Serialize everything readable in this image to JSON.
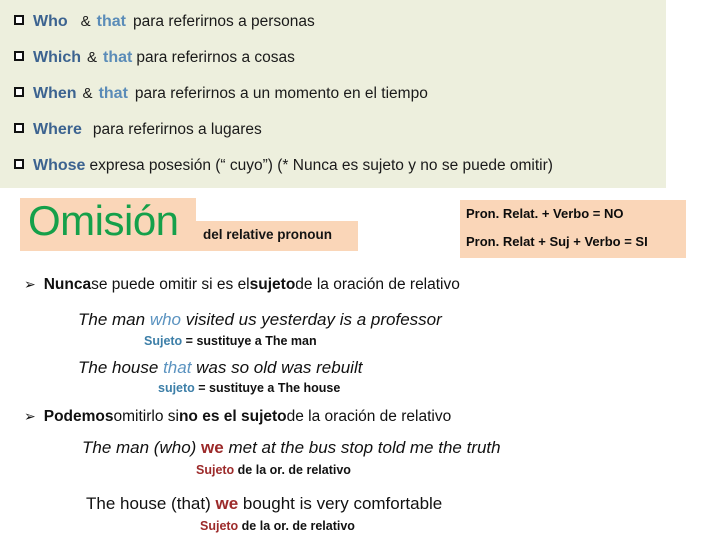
{
  "slide": {
    "title": "Relative pronouns - Omision del relative pronoun",
    "colors": {
      "panel_green": "#edefdd",
      "box_peach": "#fad6b8",
      "keyword_blue": "#3c6390",
      "keyword_light_blue": "#5b8cb8",
      "omision_green": "#15a04a",
      "highlight_red": "#9c2a2a",
      "note_blue": "#3d7fa8",
      "text_black": "#111111"
    }
  },
  "relatives_panel": {
    "bullet_glyph": "hollow-square",
    "rows": [
      {
        "pronoun": "Who",
        "conjunction": "&",
        "alt": "that",
        "description": "para referirnos a personas"
      },
      {
        "pronoun": "Which",
        "conjunction": "&",
        "alt": "that",
        "description": "para referirnos a  cosas"
      },
      {
        "pronoun": "When",
        "conjunction": "&",
        "alt": "that",
        "description": "para referirnos a un momento en el tiempo"
      },
      {
        "pronoun": "Where",
        "conjunction": "",
        "alt": "",
        "description": "para referirnos a lugares"
      },
      {
        "pronoun": "Whose",
        "conjunction": "",
        "alt": "",
        "description": "expresa posesión (“ cuyo”) (* Nunca es sujeto y no se puede omitir)"
      }
    ]
  },
  "omision": {
    "title": "Omisión",
    "subtitle": "del relative pronoun"
  },
  "rule_box": {
    "lines": [
      "Pron. Relat.  +  Verbo  =    NO",
      "Pron. Relat + Suj + Verbo = SI"
    ]
  },
  "rules": [
    {
      "arrow_glyph": "➢",
      "lead": "Nunca",
      "mid": " se puede omitir si es el ",
      "bold2": "sujeto",
      "tail": " de la oración de relativo"
    },
    {
      "arrow_glyph": "➢",
      "lead": "Podemos",
      "mid": " omitirlo si ",
      "bold2": "no es el sujeto",
      "tail": " de la oración de relativo"
    }
  ],
  "examples": [
    {
      "pre": "The man ",
      "highlight": "who",
      "post": " visited us yesterday is a professor",
      "note_label": "Sujeto",
      "note_rest": " = sustituye a The man",
      "note_color": "blue",
      "italic": true
    },
    {
      "pre": "The house ",
      "highlight": "that",
      "post": " was so old was rebuilt",
      "note_label": "sujeto",
      "note_rest": " = sustituye a The house",
      "note_color": "blue",
      "italic": true
    },
    {
      "pre": "The man (who)  ",
      "highlight": "we",
      "post": "  met at the bus stop told me the truth",
      "note_label": "Sujeto",
      "note_rest": " de la or. de relativo",
      "note_color": "red",
      "italic": true
    },
    {
      "pre": "The house (that) ",
      "highlight": "we",
      "post": " bought is very comfortable",
      "note_label": "Sujeto",
      "note_rest": " de la or. de relativo",
      "note_color": "red",
      "italic": false
    }
  ]
}
